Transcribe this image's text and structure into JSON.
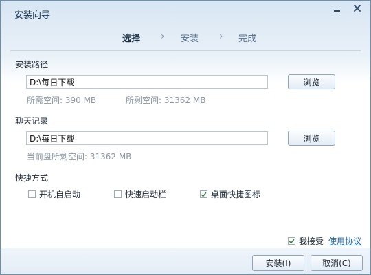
{
  "window": {
    "title": "安装向导",
    "minimize_icon": "minimize-icon",
    "close_icon": "close-icon"
  },
  "steps": [
    {
      "label": "选择",
      "active": true
    },
    {
      "label": "安装",
      "active": false
    },
    {
      "label": "完成",
      "active": false
    }
  ],
  "install_path": {
    "label": "安装路径",
    "value": "D:\\每日下载",
    "browse_label": "浏览",
    "required_space": "所需空间: 390 MB",
    "free_space": "所剩空间: 31362 MB"
  },
  "chat_history": {
    "label": "聊天记录",
    "value": "D:\\每日下载",
    "browse_label": "浏览",
    "free_space": "当前盘所剩空间: 31362 MB"
  },
  "shortcuts": {
    "label": "快捷方式",
    "options": [
      {
        "label": "开机自启动",
        "checked": false
      },
      {
        "label": "快速启动栏",
        "checked": false
      },
      {
        "label": "桌面快捷图标",
        "checked": true
      }
    ]
  },
  "agreement": {
    "accept_label": "我接受",
    "accept_checked": true,
    "link_label": "使用协议"
  },
  "footer": {
    "install_label": "安装(I)",
    "cancel_label": "取消(C)"
  },
  "colors": {
    "check": "#2f7d2f",
    "link": "#1b66b7"
  }
}
